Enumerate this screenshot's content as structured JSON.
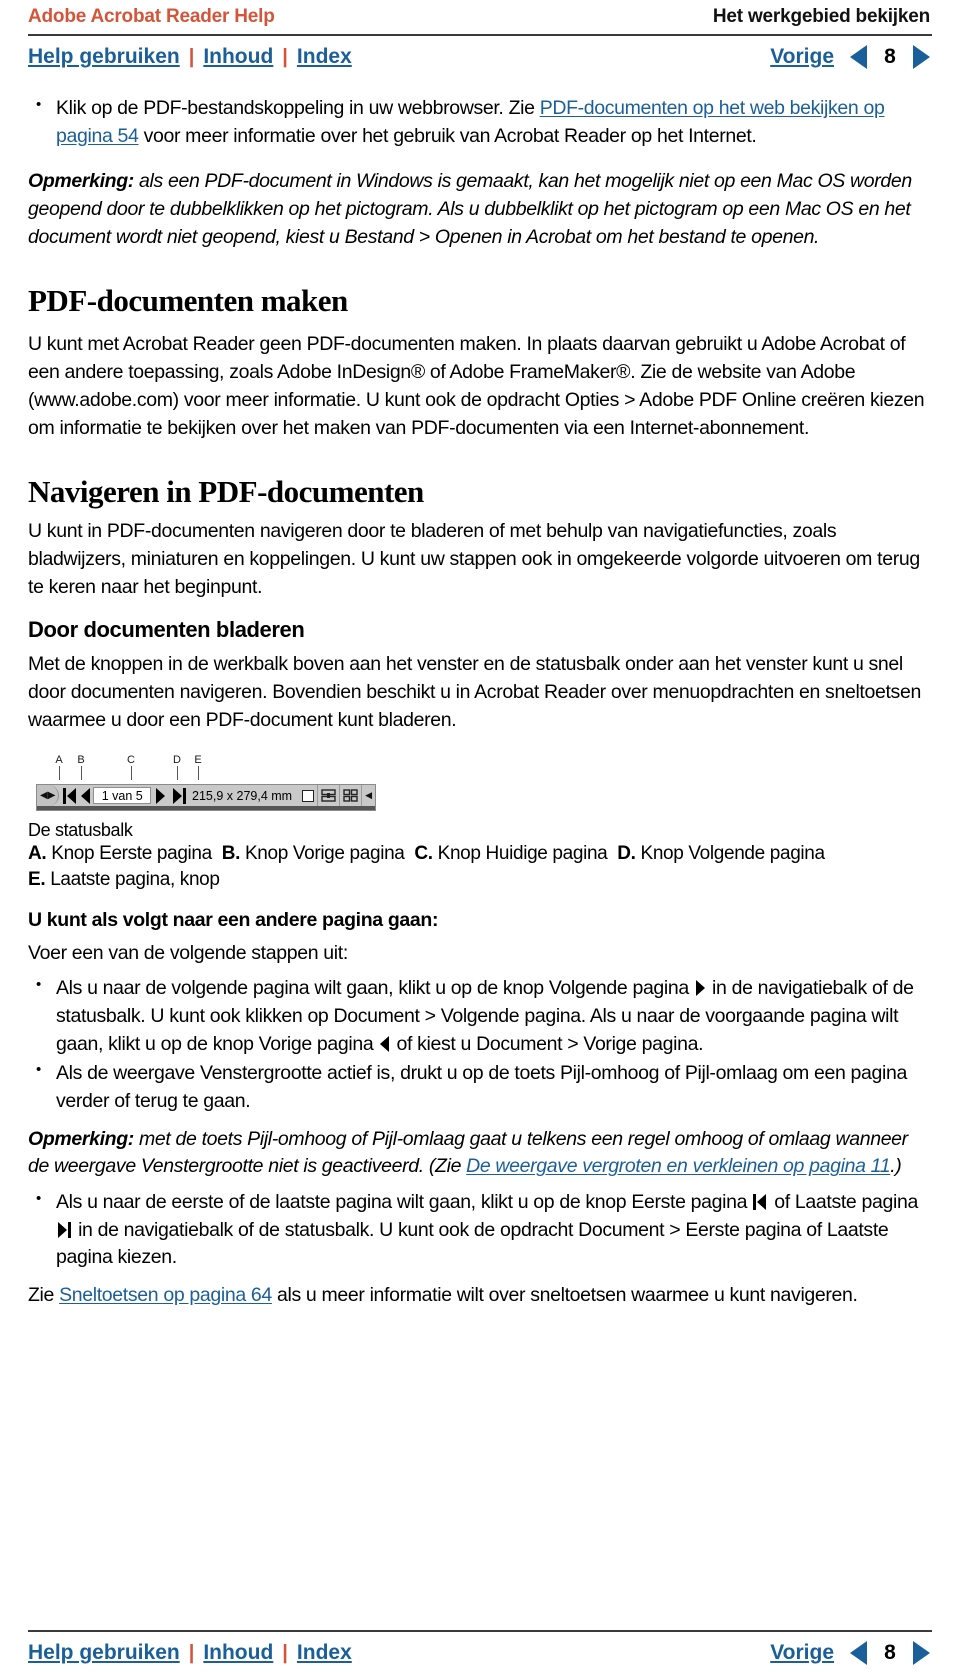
{
  "header": {
    "brand": "Adobe Acrobat Reader Help",
    "section": "Het werkgebied bekijken",
    "brand_color": "#d4553a"
  },
  "nav": {
    "help_label": "Help gebruiken",
    "sep1": "|",
    "contents_label": "Inhoud",
    "sep2": "|",
    "index_label": "Index",
    "prev_label": "Vorige",
    "page_number": "8",
    "link_color": "#1a5f99"
  },
  "body": {
    "bullet1_part1": "Klik op de PDF-bestandskoppeling in uw webbrowser. Zie ",
    "bullet1_link": "PDF-documenten op het web bekijken op pagina 54",
    "bullet1_part2": " voor meer informatie over het gebruik van Acrobat Reader op het Internet.",
    "note1_label": "Opmerking:",
    "note1_text": " als een PDF-document in Windows is gemaakt, kan het mogelijk niet op een Mac OS worden geopend door te dubbelklikken op het pictogram. Als u dubbelklikt op het pictogram op een Mac OS en het document wordt niet geopend, kiest u Bestand > Openen in Acrobat om het bestand te openen.",
    "h1_maken": "PDF-documenten maken",
    "p_maken": "U kunt met Acrobat Reader geen PDF-documenten maken. In plaats daarvan gebruikt u Adobe Acrobat of een andere toepassing, zoals Adobe InDesign® of Adobe FrameMaker®. Zie de website van Adobe (www.adobe.com) voor meer informatie. U kunt ook de opdracht Opties > Adobe PDF Online creëren kiezen om informatie te bekijken over het maken van PDF-documenten via een Internet-abonnement.",
    "h1_navigeren": "Navigeren in PDF-documenten",
    "p_navigeren": "U kunt in PDF-documenten navigeren door te bladeren of met behulp van navigatiefuncties, zoals bladwijzers, miniaturen en koppelingen. U kunt uw stappen ook in omgekeerde volgorde uitvoeren om terug te keren naar het beginpunt.",
    "h2_bladeren": "Door documenten bladeren",
    "p_bladeren": "Met de knoppen in de werkbalk boven aan het venster en de statusbalk onder aan het venster kunt u snel door documenten navigeren. Bovendien beschikt u in Acrobat Reader over menuopdrachten en sneltoetsen waarmee u door een PDF-document kunt bladeren."
  },
  "figure": {
    "callouts": [
      "A",
      "B",
      "C",
      "D",
      "E"
    ],
    "page_field": "1 van 5",
    "dimensions": "215,9 x 279,4 mm",
    "caption": "De statusbalk",
    "legend_a_key": "A.",
    "legend_a_text": " Knop Eerste pagina",
    "legend_b_key": "B.",
    "legend_b_text": " Knop Vorige pagina",
    "legend_c_key": "C.",
    "legend_c_text": " Knop Huidige pagina",
    "legend_d_key": "D.",
    "legend_d_text": " Knop Volgende pagina",
    "legend_e_key": "E.",
    "legend_e_text": " Laatste pagina, knop"
  },
  "howto": {
    "lead": "U kunt als volgt naar een andere pagina gaan:",
    "intro": "Voer een van de volgende stappen uit:",
    "b1_part1": "Als u naar de volgende pagina wilt gaan, klikt u op de knop Volgende pagina ",
    "b1_part2": " in de navigatiebalk of de statusbalk. U kunt ook klikken op Document > Volgende pagina. Als u naar de voorgaande pagina wilt gaan, klikt u op de knop Vorige pagina ",
    "b1_part3": " of kiest u Document > Vorige pagina.",
    "b2_text": "Als de weergave Venstergrootte actief is, drukt u op de toets Pijl-omhoog of Pijl-omlaag om een pagina verder of terug te gaan.",
    "note2_label": "Opmerking:",
    "note2_text1": " met de toets Pijl-omhoog of Pijl-omlaag gaat u telkens een regel omhoog of omlaag wanneer de weergave Venstergrootte niet is geactiveerd. (Zie ",
    "note2_link": "De weergave vergroten en verkleinen op pagina 11",
    "note2_text2": ".)",
    "b3_part1": "Als u naar de eerste of de laatste pagina wilt gaan, klikt u op de knop Eerste pagina ",
    "b3_part2": " of Laatste pagina ",
    "b3_part3": " in de navigatiebalk of de statusbalk. U kunt ook de opdracht Document > Eerste pagina of Laatste pagina kiezen.",
    "closing_part1": "Zie ",
    "closing_link": "Sneltoetsen op pagina 64",
    "closing_part2": " als u meer informatie wilt over sneltoetsen waarmee u kunt navigeren."
  },
  "footer": {
    "help_label": "Help gebruiken",
    "sep1": "|",
    "contents_label": "Inhoud",
    "sep2": "|",
    "index_label": "Index",
    "prev_label": "Vorige",
    "page_number": "8"
  },
  "icons": {
    "next_page": "triangle-right-icon",
    "prev_page": "triangle-left-icon",
    "first_page": "first-page-icon",
    "last_page": "last-page-icon"
  }
}
